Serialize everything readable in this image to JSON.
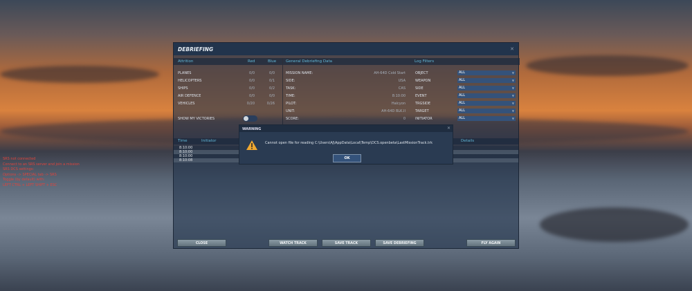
{
  "srs": {
    "lines": [
      "SRS not connected",
      "Connect to an SRS server and join a mission",
      "SRS DCS settings:",
      "Options -> SPECIAL tab -> SRS",
      "Toggle (by default) with:",
      "LEFT CTRL + LEFT SHIFT + ESC"
    ],
    "color": "#e0443c"
  },
  "debrief": {
    "title": "DEBRIEFING",
    "attrition": {
      "header": "Attrition",
      "red": "Red",
      "blue": "Blue",
      "rows": [
        {
          "label": "PLANES",
          "red": "0/0",
          "blue": "0/0"
        },
        {
          "label": "HELICOPTERS",
          "red": "0/0",
          "blue": "0/1"
        },
        {
          "label": "SHIPS",
          "red": "0/0",
          "blue": "0/2"
        },
        {
          "label": "AIR DEFENCE",
          "red": "0/0",
          "blue": "0/0"
        },
        {
          "label": "VEHICLES",
          "red": "0/20",
          "blue": "0/26"
        }
      ],
      "show_victories": "SHOW MY VICTORIES",
      "show_victories_on": false
    },
    "general": {
      "header": "General Debriefing Data",
      "rows": [
        {
          "label": "MISSION NAME:",
          "value": "AH-64D Cold Start"
        },
        {
          "label": "SIDE:",
          "value": "USA"
        },
        {
          "label": "TASK:",
          "value": "CAS"
        },
        {
          "label": "TIME:",
          "value": "8:10:00"
        },
        {
          "label": "PILOT:",
          "value": "Halcyon"
        },
        {
          "label": "UNIT:",
          "value": "AH-64D BLK.II"
        },
        {
          "label": "SCORE:",
          "value": "0"
        },
        {
          "label": "RESULT:",
          "value": "0"
        }
      ]
    },
    "filters": {
      "header": "Log Filters",
      "rows": [
        {
          "label": "OBJECT",
          "value": "ALL"
        },
        {
          "label": "WEAPON",
          "value": "ALL"
        },
        {
          "label": "SIDE",
          "value": "ALL"
        },
        {
          "label": "EVENT",
          "value": "ALL"
        },
        {
          "label": "TRGSIDE",
          "value": "ALL"
        },
        {
          "label": "TARGET",
          "value": "ALL"
        },
        {
          "label": "INITIATOR",
          "value": "ALL"
        }
      ]
    },
    "log": {
      "columns": {
        "time": "Time",
        "initiator": "Initiator",
        "details": "Details"
      },
      "times": [
        "8:10:00",
        "8:10:00",
        "8:10:00",
        "8:10:08"
      ]
    },
    "buttons": {
      "close": "CLOSE",
      "watch": "WATCH TRACK",
      "save_track": "SAVE TRACK",
      "save_debrief": "SAVE DEBRIEFING",
      "fly_again": "FLY AGAIN"
    }
  },
  "warning": {
    "title": "WARNING",
    "message": "Cannot open file for reading C:\\Users\\AJ\\AppData\\Local\\Temp\\DCS.openbeta\\LastMissionTrack.trk",
    "ok": "OK",
    "icon_color": "#f0a830"
  }
}
